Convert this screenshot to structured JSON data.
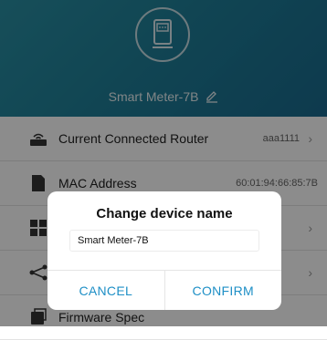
{
  "header": {
    "device_icon": "smart-meter-icon",
    "device_name": "Smart Meter-7B",
    "edit_icon": "edit-icon"
  },
  "list": {
    "items": [
      {
        "icon": "router-icon",
        "label": "Current Connected Router",
        "value": "aaa1111"
      },
      {
        "icon": "document-icon",
        "label": "MAC Address",
        "value": "60:01:94:66:85:7B"
      },
      {
        "icon": "grid-icon",
        "label": "",
        "value": ""
      },
      {
        "icon": "network-icon",
        "label": "",
        "value": ""
      },
      {
        "icon": "chip-icon",
        "label": "Firmware Spec",
        "value": ""
      }
    ]
  },
  "dialog": {
    "title": "Change device name",
    "input_value": "Smart Meter-7B",
    "cancel_label": "CANCEL",
    "confirm_label": "CONFIRM"
  },
  "colors": {
    "header_gradient": [
      "#2a8fa3",
      "#1a6a8e"
    ],
    "accent": "#1e8fc6",
    "overlay": "rgba(0,0,0,0.45)"
  }
}
